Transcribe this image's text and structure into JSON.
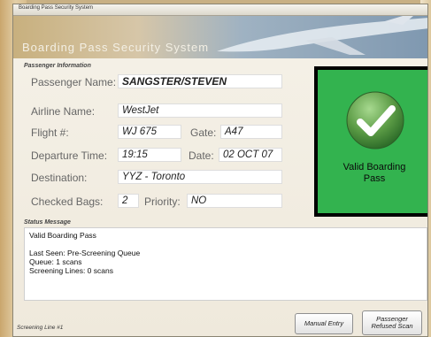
{
  "window": {
    "title": "Boarding Pass Security System"
  },
  "banner": {
    "title": "Boarding Pass Security System"
  },
  "passenger": {
    "section_label": "Passenger Information",
    "name_label": "Passenger Name:",
    "name_value": "SANGSTER/STEVEN",
    "airline_label": "Airline Name:",
    "airline_value": "WestJet",
    "flight_label": "Flight #:",
    "flight_value": "WJ 675",
    "gate_label": "Gate:",
    "gate_value": "A47",
    "departure_label": "Departure Time:",
    "departure_value": "19:15",
    "date_label": "Date:",
    "date_value": "02 OCT 07",
    "destination_label": "Destination:",
    "destination_value": "YYZ - Toronto",
    "bags_label": "Checked Bags:",
    "bags_value": "2",
    "priority_label": "Priority:",
    "priority_value": "NO"
  },
  "result": {
    "line1": "Valid Boarding",
    "line2": "Pass",
    "color": "#33b34f",
    "icon": "checkmark-icon"
  },
  "status": {
    "section_label": "Status Message",
    "line1": "Valid Boarding Pass",
    "line2": "Last Seen: Pre-Screening Queue",
    "line3": "Queue: 1 scans",
    "line4": "Screening Lines: 0 scans"
  },
  "footer": {
    "screening_line": "Screening Line #1",
    "manual_entry": "Manual Entry",
    "refused_line1": "Passenger",
    "refused_line2": "Refused Scan"
  }
}
